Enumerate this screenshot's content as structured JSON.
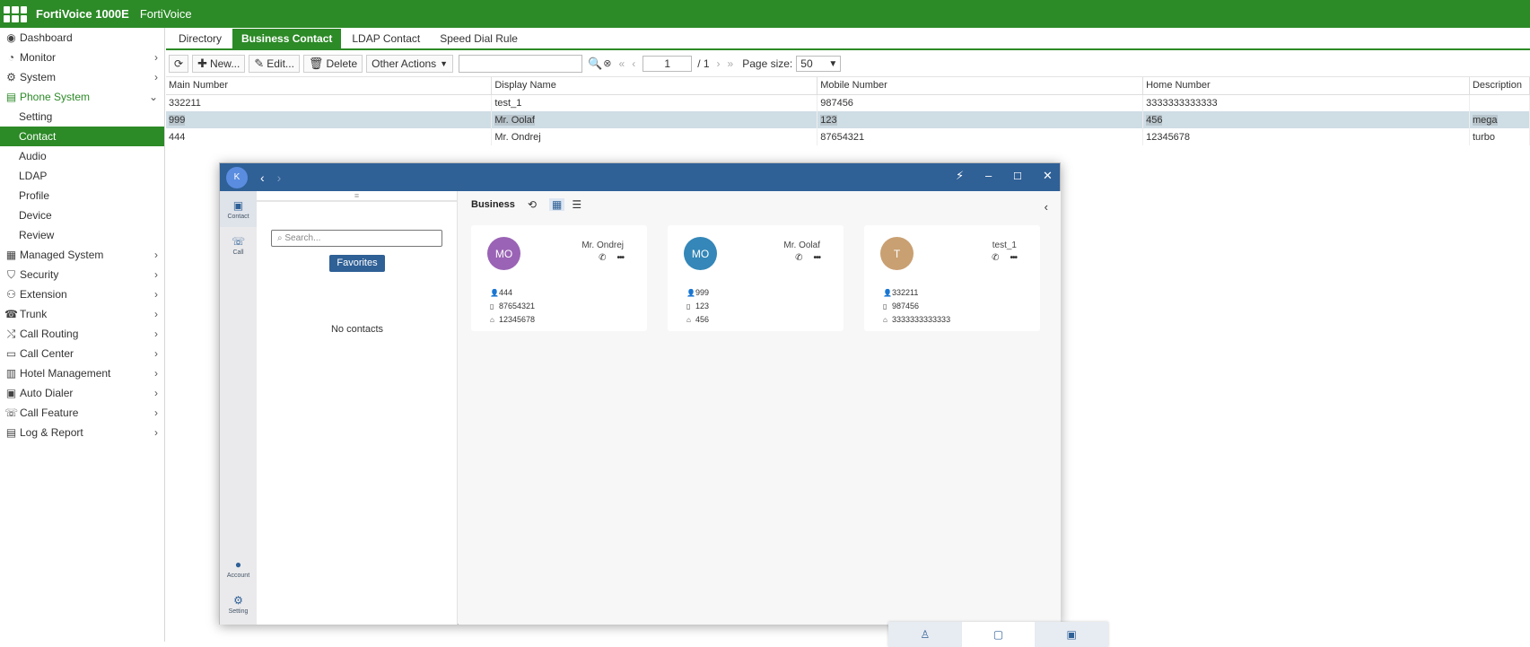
{
  "app": {
    "product": "FortiVoice 1000E",
    "hostname": "FortiVoice"
  },
  "sidebar": {
    "items": [
      {
        "label": "Dashboard",
        "icon": "dashboard-icon",
        "glyph": "◉",
        "chevron": ""
      },
      {
        "label": "Monitor",
        "icon": "monitor-icon",
        "glyph": "◔",
        "chevron": "›"
      },
      {
        "label": "System",
        "icon": "gear-icon",
        "glyph": "⚙",
        "chevron": "›"
      },
      {
        "label": "Phone System",
        "icon": "phone-system-icon",
        "glyph": "▤",
        "chevron": "⌄"
      }
    ],
    "phone_system_sub": [
      "Setting",
      "Contact",
      "Audio",
      "LDAP",
      "Profile",
      "Device",
      "Review"
    ],
    "rest": [
      {
        "label": "Managed System",
        "icon": "managed-system-icon",
        "glyph": "▦"
      },
      {
        "label": "Security",
        "icon": "shield-icon",
        "glyph": "⛉"
      },
      {
        "label": "Extension",
        "icon": "extension-icon",
        "glyph": "⚇"
      },
      {
        "label": "Trunk",
        "icon": "trunk-icon",
        "glyph": "☎"
      },
      {
        "label": "Call Routing",
        "icon": "routing-icon",
        "glyph": "⤭"
      },
      {
        "label": "Call Center",
        "icon": "call-center-icon",
        "glyph": "▭"
      },
      {
        "label": "Hotel Management",
        "icon": "hotel-icon",
        "glyph": "▥"
      },
      {
        "label": "Auto Dialer",
        "icon": "auto-dialer-icon",
        "glyph": "▣"
      },
      {
        "label": "Call Feature",
        "icon": "call-feature-icon",
        "glyph": "☏"
      },
      {
        "label": "Log & Report",
        "icon": "log-report-icon",
        "glyph": "▤"
      }
    ],
    "chevron": "›"
  },
  "tabs": [
    "Directory",
    "Business Contact",
    "LDAP Contact",
    "Speed Dial Rule"
  ],
  "toolbar": {
    "new_label": "New...",
    "edit_label": "Edit...",
    "delete_label": "Delete",
    "other_actions_label": "Other Actions",
    "page_current": "1",
    "page_total": "/ 1",
    "page_size_label": "Page size:",
    "page_size_value": "50"
  },
  "table": {
    "columns": [
      "Main Number",
      "Display Name",
      "Mobile Number",
      "Home Number",
      "Description"
    ],
    "rows": [
      [
        "332211",
        "test_1",
        "987456",
        "3333333333333",
        ""
      ],
      [
        "999",
        "Mr. Oolaf",
        "123",
        "456",
        "mega"
      ],
      [
        "444",
        "Mr. Ondrej",
        "87654321",
        "12345678",
        "turbo"
      ]
    ]
  },
  "window": {
    "avatar_letter": "K",
    "rail": {
      "contact": "Contact",
      "call": "Call",
      "account": "Account",
      "setting": "Setting"
    },
    "search_placeholder": "Search...",
    "favorites_label": "Favorites",
    "no_contacts": "No contacts",
    "content_title": "Business",
    "cards": [
      {
        "initials": "MO",
        "name": "Mr. Ondrej",
        "color": "#9a63b5",
        "main": "444",
        "mobile": "87654321",
        "home": "12345678"
      },
      {
        "initials": "MO",
        "name": "Mr. Oolaf",
        "color": "#3487b8",
        "main": "999",
        "mobile": "123",
        "home": "456"
      },
      {
        "initials": "T",
        "name": "test_1",
        "color": "#c9a072",
        "main": "332211",
        "mobile": "987456",
        "home": "3333333333333"
      }
    ]
  },
  "colors": {
    "brand_green": "#2c8a27",
    "window_blue": "#2f6096",
    "selected_row": "#cfdde5"
  }
}
